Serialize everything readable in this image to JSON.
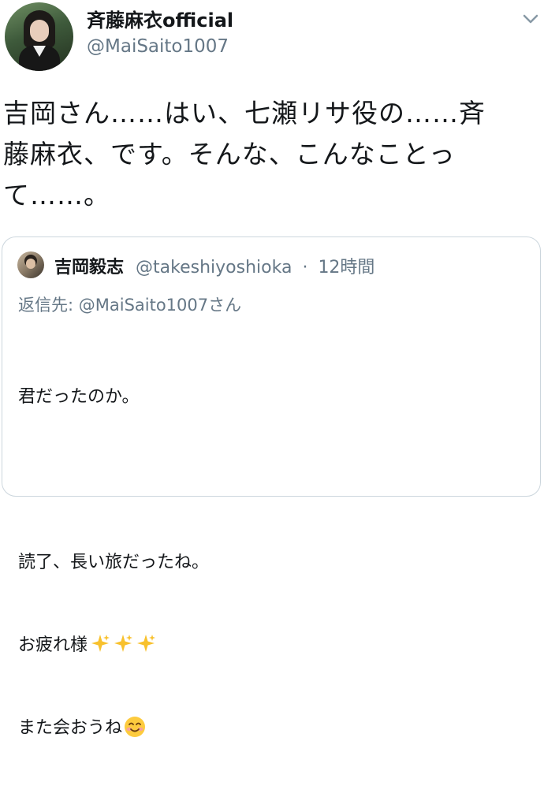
{
  "author": {
    "display_name": "斉藤麻衣official",
    "handle": "@MaiSaito1007",
    "avatar_icon": "profile-photo"
  },
  "tweet": {
    "text": "吉岡さん……はい、七瀬リサ役の……斉\n藤麻衣、です。そんな、こんなことっ\nて……。"
  },
  "quote": {
    "author_name": "吉岡毅志",
    "handle": "@takeshiyoshioka",
    "separator": "·",
    "time": "12時間",
    "reply_to": "返信先: @MaiSaito1007さん",
    "line1": "君だったのか。",
    "line2": "",
    "line3": "読了、長い旅だったね。",
    "line4": "お疲れ様",
    "line5": "また会おうね",
    "emoji_sparkles": "sparkles-emoji",
    "emoji_smile": "smiling-face-emoji"
  },
  "colors": {
    "text": "#14171a",
    "secondary": "#657786",
    "border": "#ccd6dd",
    "sparkle": "#f8c12d"
  }
}
